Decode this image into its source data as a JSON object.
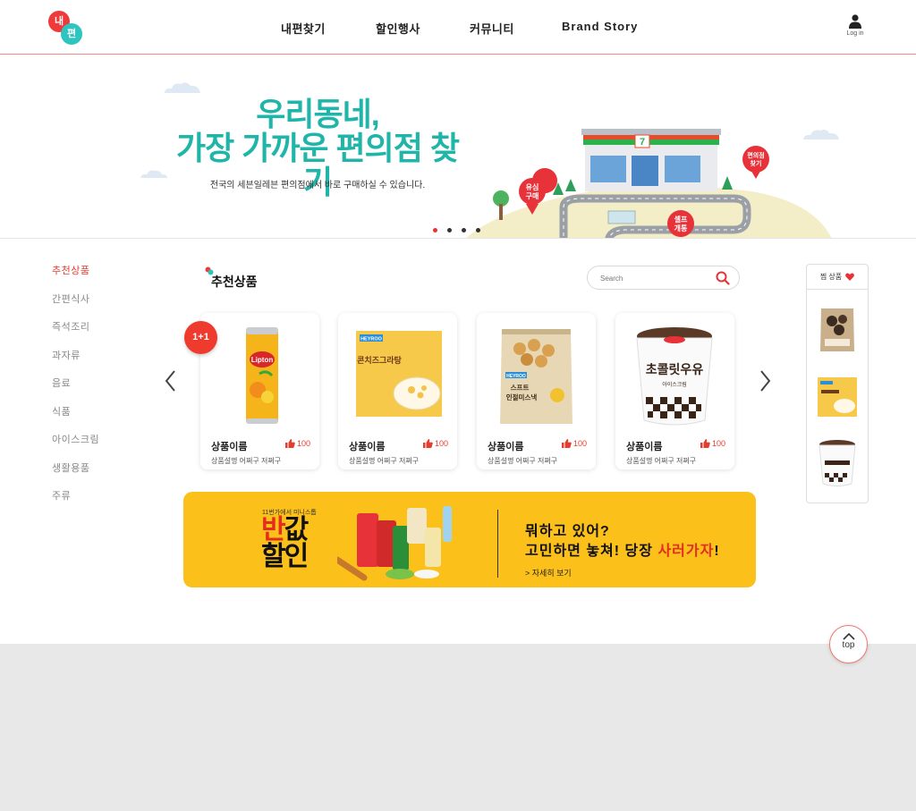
{
  "header": {
    "logo_top": "내",
    "logo_bottom": "편",
    "nav": [
      "내편찾기",
      "할인행사",
      "커뮤니티",
      "Brand Story"
    ],
    "login_label": "Log in"
  },
  "banner": {
    "title_line1": "우리동네,",
    "title_line2": "가장 가까운 편의점 찾기",
    "subtitle": "전국의 세븐일레븐 편의점에서 바로 구매하실 수 있습니다.",
    "pins": [
      "유심\n구매",
      "편의점\n찾기",
      "셀프\n개통"
    ],
    "store_logo": "7",
    "slide_count": 4,
    "active_slide": 1
  },
  "sidebar": {
    "items": [
      "추천상품",
      "간편식사",
      "즉석조리",
      "과자류",
      "음료",
      "식품",
      "아이스크림",
      "생활용품",
      "주류"
    ],
    "active_index": 0
  },
  "section": {
    "title": "추천상품",
    "search_placeholder": "Search"
  },
  "products": [
    {
      "name": "상품이름",
      "likes": "100",
      "desc": "상품설명 어쩌구 저쩌구",
      "badge": "1+1",
      "icon": "lipton-can"
    },
    {
      "name": "상품이름",
      "likes": "100",
      "desc": "상품설명 어쩌구 저쩌구",
      "label": "콘치즈그라탕",
      "brand": "HEYROO",
      "icon": "gratin-box"
    },
    {
      "name": "상품이름",
      "likes": "100",
      "desc": "상품설명 어쩌구 저쩌구",
      "label": "스프트\n인절미스낵",
      "brand": "HEYROO",
      "icon": "snack-bag"
    },
    {
      "name": "상품이름",
      "likes": "100",
      "desc": "상품설명 어쩌구 저쩌구",
      "label": "초콜릿우유",
      "sub": "아이스크림",
      "icon": "ice-cream-cup"
    }
  ],
  "promo": {
    "small": "11번가에서 미니스톱",
    "big_red": "반",
    "big_rest1": "값",
    "big_line2": "할인",
    "line1": "뭐하고 있어?",
    "line2_pre": "고민하면 놓쳐! 당장 ",
    "line2_hl": "사러가자",
    "line2_post": "!",
    "more": "> 자세히 보기"
  },
  "wish": {
    "title": "찜 상품"
  },
  "top_button": "top",
  "colors": {
    "accent": "#e63c2f",
    "teal": "#1fb5a8",
    "promo_yellow": "#fcc01a",
    "footer_gray": "#e8e8e8"
  }
}
